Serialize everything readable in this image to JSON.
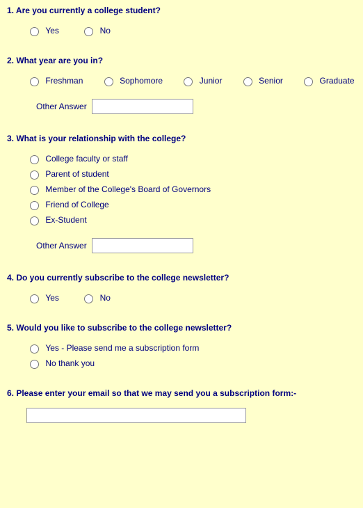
{
  "q1": {
    "text": "1. Are you currently a college student?",
    "options": [
      "Yes",
      "No"
    ]
  },
  "q2": {
    "text": "2. What year are you in?",
    "options": [
      "Freshman",
      "Sophomore",
      "Junior",
      "Senior",
      "Graduate"
    ],
    "other_label": "Other Answer",
    "other_value": ""
  },
  "q3": {
    "text": "3. What is your relationship with the college?",
    "options": [
      "College faculty or staff",
      "Parent of student",
      "Member of the College's Board of Governors",
      "Friend of College",
      "Ex-Student"
    ],
    "other_label": "Other Answer",
    "other_value": ""
  },
  "q4": {
    "text": "4. Do you currently subscribe to the college newsletter?",
    "options": [
      "Yes",
      "No"
    ]
  },
  "q5": {
    "text": "5. Would you like to subscribe to the college newsletter?",
    "options": [
      "Yes - Please send me a subscription form",
      "No thank you"
    ]
  },
  "q6": {
    "text": "6. Please enter your email so that we may send you a subscription form:-",
    "value": ""
  }
}
